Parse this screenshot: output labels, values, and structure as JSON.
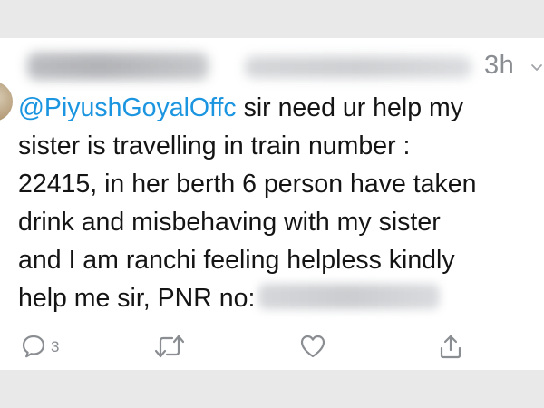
{
  "tweet": {
    "timestamp": "3h",
    "text_lines": [
      {
        "mention": "@PiyushGoyalOffc",
        "text": " sir need ur help my"
      },
      {
        "text": "sister is travelling in train number :"
      },
      {
        "text": "22415, in her berth 6 person have taken"
      },
      {
        "text": "drink and misbehaving with my sister"
      },
      {
        "text": "and I am ranchi feeling helpless kindly"
      },
      {
        "text": "help me sir, PNR no:"
      }
    ]
  },
  "actions": {
    "reply_count": "3",
    "icons": [
      "reply-icon",
      "retweet-icon",
      "like-icon",
      "share-icon"
    ]
  },
  "colors": {
    "mention": "#1b95e0",
    "icon": "#8a8d91",
    "text": "#141414"
  }
}
